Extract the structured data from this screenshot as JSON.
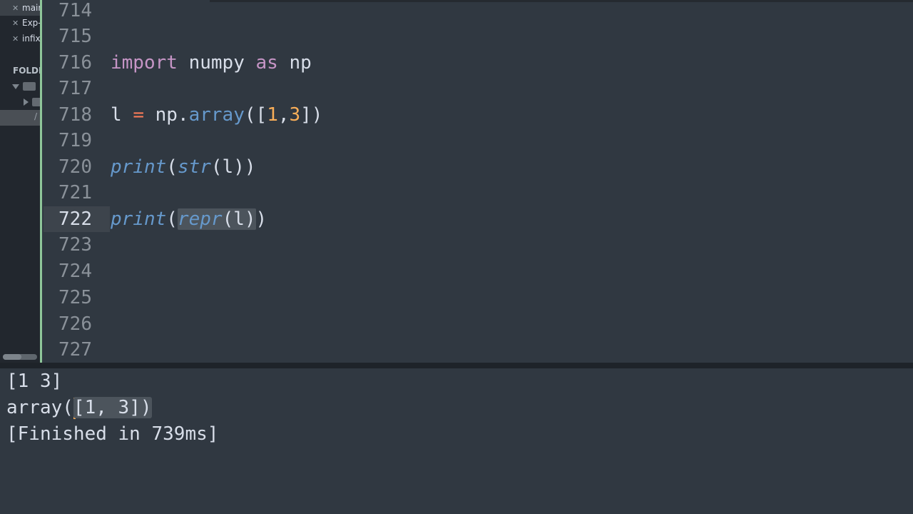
{
  "sidebar": {
    "open_files": [
      {
        "name": "main",
        "active": true
      },
      {
        "name": "Exp-",
        "active": false
      },
      {
        "name": "infix",
        "active": false
      }
    ],
    "folders_label": "FOLDERS",
    "selected_item": "/"
  },
  "editor": {
    "lines": [
      {
        "number": "714",
        "code": ""
      },
      {
        "number": "715",
        "code": ""
      },
      {
        "number": "716",
        "code": "import numpy as np"
      },
      {
        "number": "717",
        "code": ""
      },
      {
        "number": "718",
        "code": "l = np.array([1,3])"
      },
      {
        "number": "719",
        "code": ""
      },
      {
        "number": "720",
        "code": "print(str(l))"
      },
      {
        "number": "721",
        "code": ""
      },
      {
        "number": "722",
        "code": "print(repr(l))",
        "current": true
      },
      {
        "number": "723",
        "code": ""
      },
      {
        "number": "724",
        "code": ""
      },
      {
        "number": "725",
        "code": ""
      },
      {
        "number": "726",
        "code": ""
      },
      {
        "number": "727",
        "code": ""
      }
    ],
    "tokens": {
      "import": "import",
      "numpy": " numpy ",
      "as": "as",
      "np": " np",
      "l": "l",
      "eq": "=",
      "np2": "np",
      "dot": ".",
      "array": "array",
      "open": "([",
      "n1": "1",
      "comma": ",",
      "n3": "3",
      "close": "])",
      "print": "print",
      "paren": "(",
      "str": "str",
      "arg": "(l))",
      "repr": "repr",
      "repr_arg": "(l)",
      "close2": ")"
    },
    "syntax_colors": {
      "keyword": "#c695c6",
      "function": "#6699cc",
      "number": "#f9ae58",
      "operator": "#f97b58"
    }
  },
  "output": {
    "lines": [
      "[1 3]",
      "array([1, 3])",
      "[Finished in 739ms]"
    ],
    "array_prefix": "array(",
    "array_selected": "[1, 3])",
    "finished": "[Finished in 739ms]",
    "first": "[1 3]"
  }
}
